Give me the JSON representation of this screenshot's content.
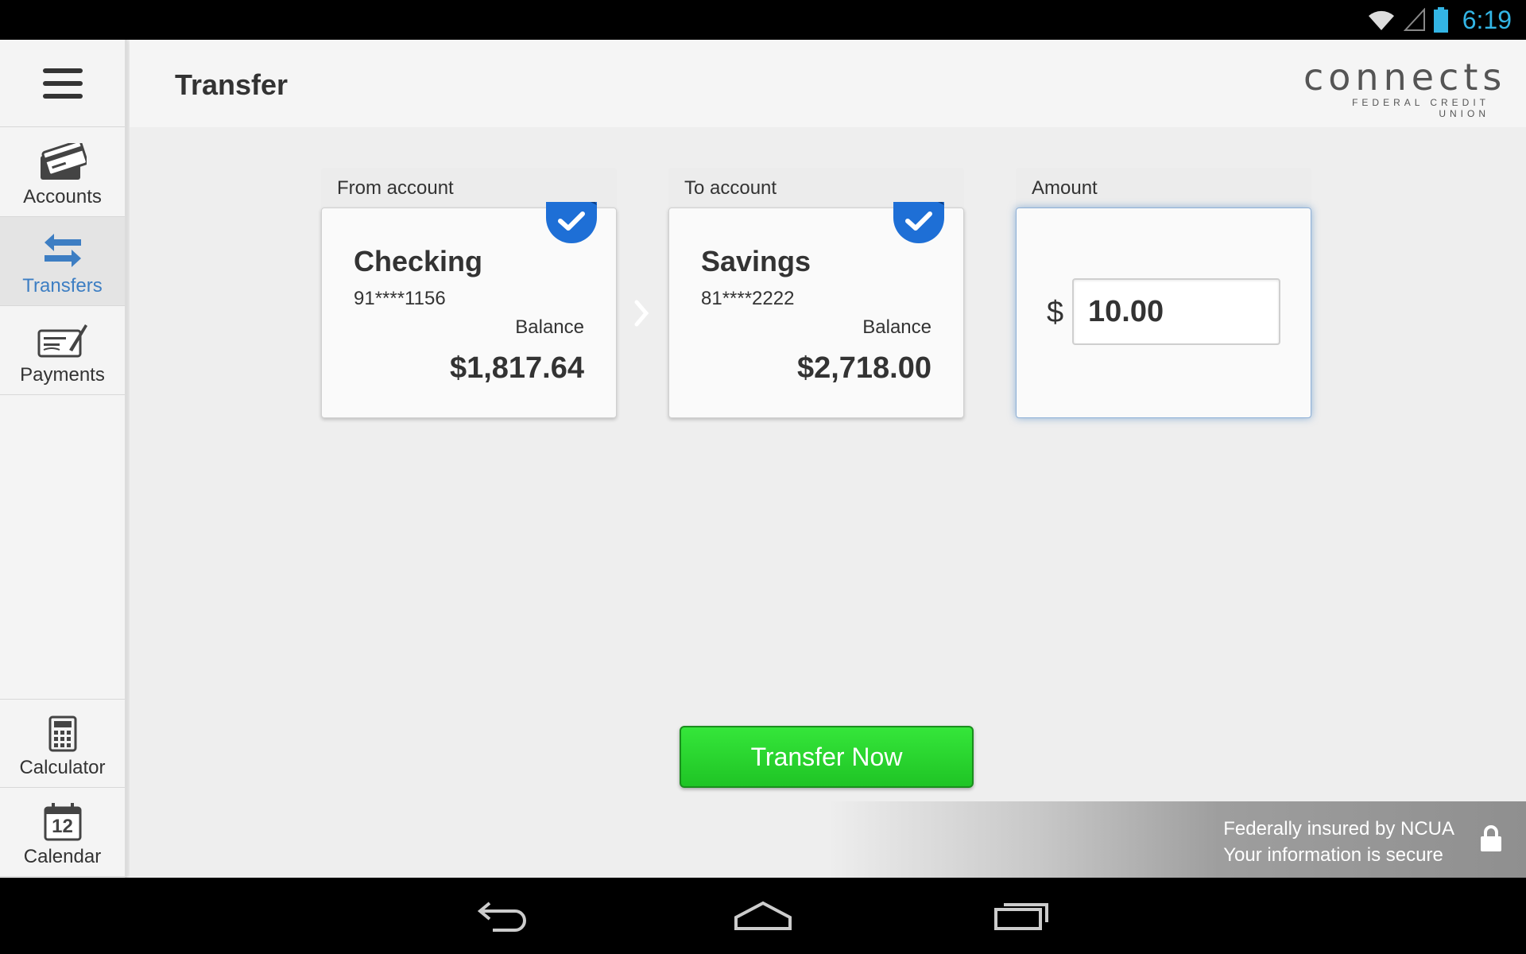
{
  "status_bar": {
    "time": "6:19"
  },
  "sidebar": {
    "menu_icon": "hamburger-menu-icon",
    "items": [
      {
        "label": "Accounts",
        "icon": "credit-card-icon"
      },
      {
        "label": "Transfers",
        "icon": "transfer-arrows-icon",
        "active": true
      },
      {
        "label": "Payments",
        "icon": "check-pen-icon"
      }
    ],
    "bottom_items": [
      {
        "label": "Calculator",
        "icon": "calculator-icon"
      },
      {
        "label": "Calendar",
        "icon": "calendar-icon",
        "calendar_day": "12"
      }
    ]
  },
  "header": {
    "title": "Transfer",
    "logo_text": "connects",
    "logo_subtitle": "FEDERAL CREDIT UNION"
  },
  "from_account": {
    "tab_label": "From account",
    "name": "Checking",
    "number": "91****1156",
    "balance_label": "Balance",
    "balance": "$1,817.64"
  },
  "to_account": {
    "tab_label": "To account",
    "name": "Savings",
    "number": "81****2222",
    "balance_label": "Balance",
    "balance": "$2,718.00"
  },
  "amount": {
    "tab_label": "Amount",
    "currency": "$",
    "value": "10.00"
  },
  "transfer_button": "Transfer Now",
  "footer": {
    "line1": "Federally insured by NCUA",
    "line2": "Your information is secure"
  },
  "colors": {
    "accent_blue": "#3d7ec3",
    "button_green": "#27d12c",
    "status_time": "#33b5e5"
  }
}
